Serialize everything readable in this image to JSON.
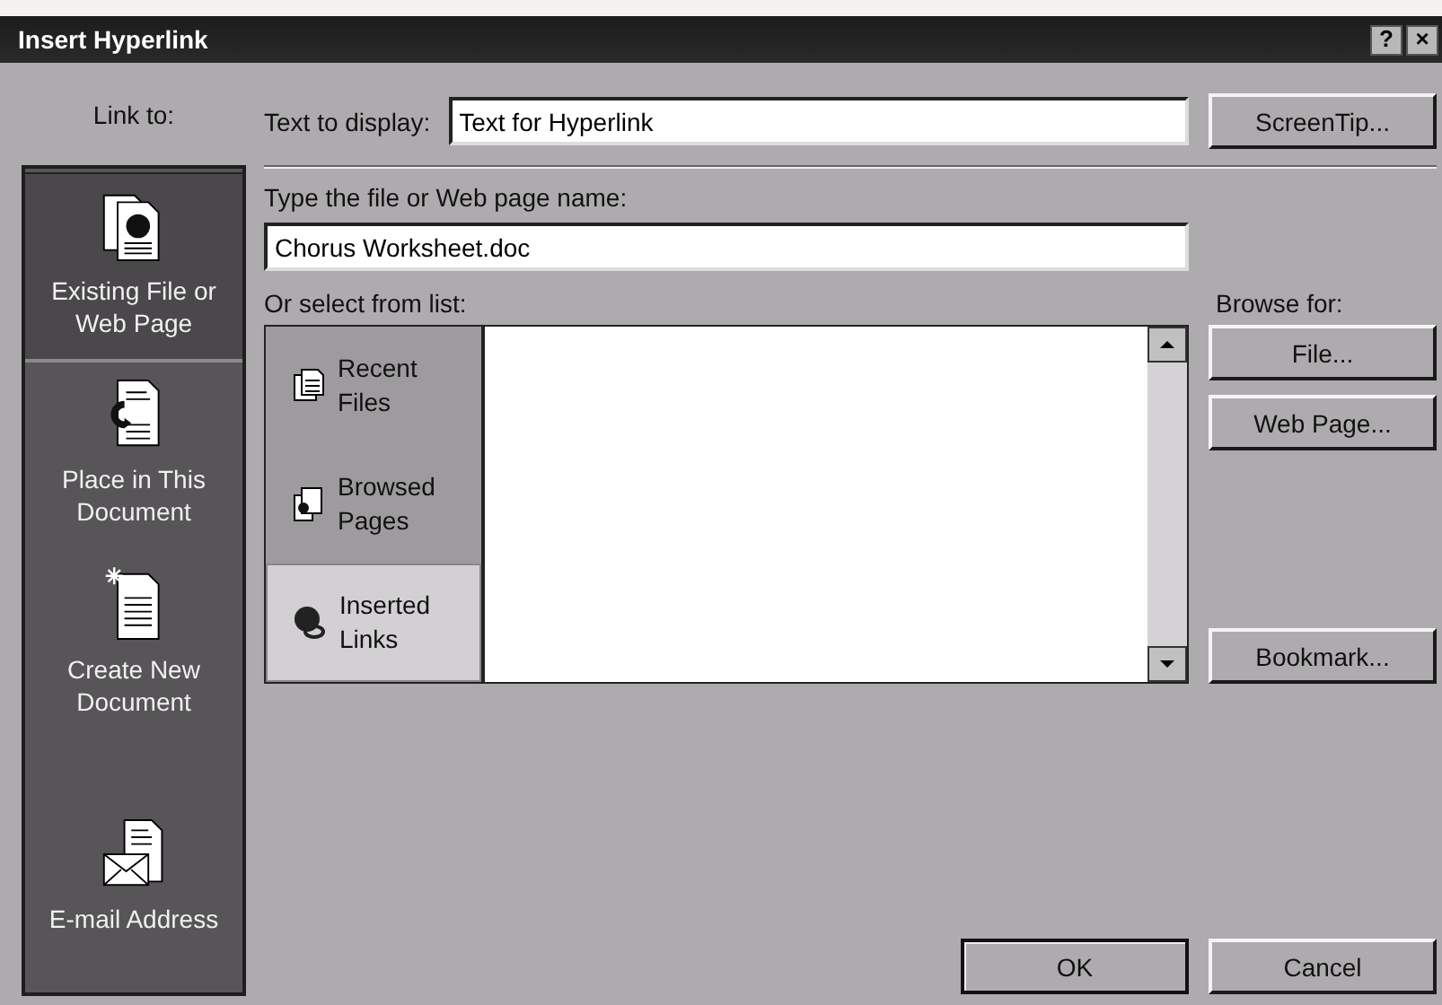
{
  "window": {
    "title": "Insert Hyperlink",
    "title_buttons": [
      "?",
      "×"
    ]
  },
  "link_to": {
    "label": "Link to:",
    "items": [
      {
        "kind": "existing",
        "label": "Existing File or Web Page",
        "selected": true
      },
      {
        "kind": "place",
        "label": "Place in This Document",
        "selected": false
      },
      {
        "kind": "new",
        "label": "Create New Document",
        "selected": false
      },
      {
        "kind": "email",
        "label": "E-mail Address",
        "selected": false
      }
    ]
  },
  "text_to_display": {
    "label": "Text to display:",
    "value": "Text for Hyperlink"
  },
  "screentip_button": "ScreenTip...",
  "address": {
    "label": "Type the file or Web page name:",
    "value": "Chorus Worksheet.doc"
  },
  "select_label": "Or select from list:",
  "list_tabs": [
    {
      "kind": "recent",
      "label": "Recent Files",
      "selected": false
    },
    {
      "kind": "browsed",
      "label": "Browsed Pages",
      "selected": false
    },
    {
      "kind": "inserted",
      "label": "Inserted Links",
      "selected": true
    }
  ],
  "browse": {
    "label": "Browse for:",
    "buttons": [
      "File...",
      "Web Page..."
    ]
  },
  "bookmark_button": "Bookmark...",
  "buttons": [
    "OK",
    "Cancel"
  ]
}
